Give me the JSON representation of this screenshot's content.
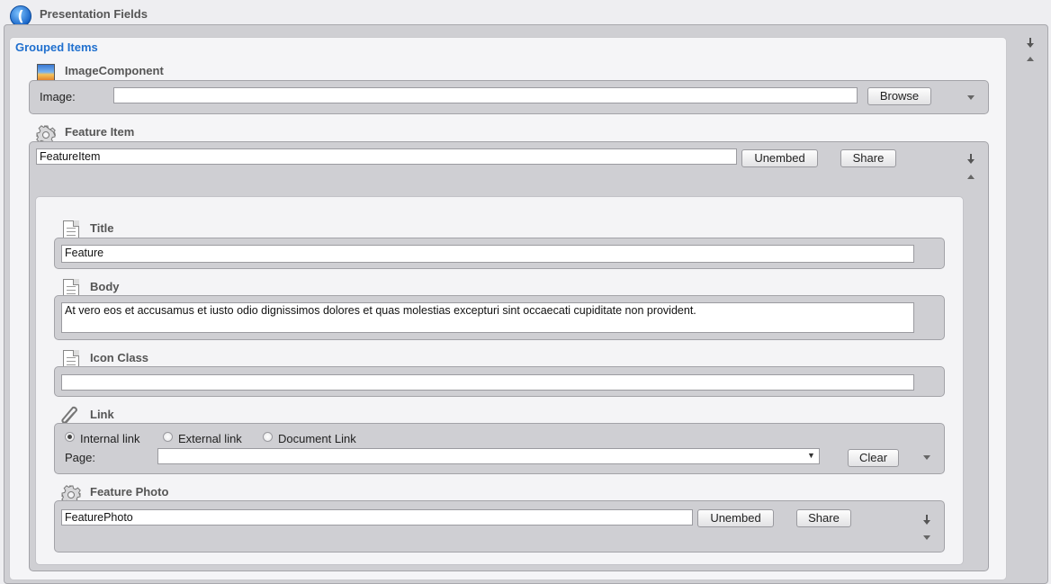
{
  "header": {
    "title": "Presentation Fields"
  },
  "grouped": {
    "title": "Grouped Items"
  },
  "image_component": {
    "title": "ImageComponent",
    "image_label": "Image:",
    "image_value": "",
    "browse_label": "Browse"
  },
  "feature_item": {
    "title": "Feature Item",
    "value": "FeatureItem",
    "unembed_label": "Unembed",
    "share_label": "Share",
    "fields": {
      "title": {
        "label": "Title",
        "value": "Feature"
      },
      "body": {
        "label": "Body",
        "value": "At vero eos et accusamus et iusto odio dignissimos dolores et quas molestias excepturi sint occaecati cupiditate non provident."
      },
      "icon_class": {
        "label": "Icon Class",
        "value": ""
      },
      "link": {
        "label": "Link",
        "options": [
          "Internal link",
          "External link",
          "Document Link"
        ],
        "selected": "Internal link",
        "page_label": "Page:",
        "page_value": "",
        "clear_label": "Clear"
      },
      "feature_photo": {
        "title": "Feature Photo",
        "value": "FeaturePhoto",
        "unembed_label": "Unembed",
        "share_label": "Share"
      }
    }
  }
}
